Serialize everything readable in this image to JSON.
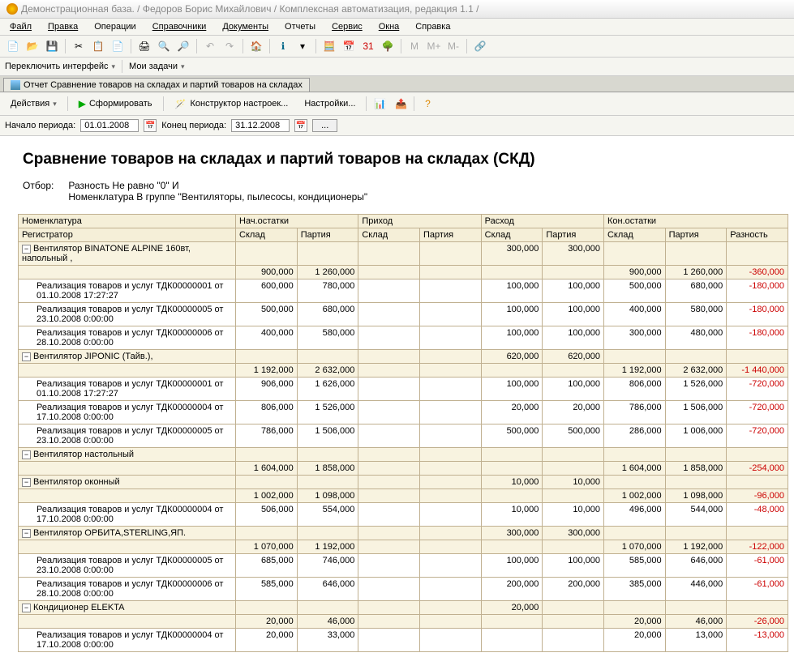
{
  "title": "Демонстрационная база. / Федоров Борис Михайлович / Комплексная автоматизация, редакция 1.1 /",
  "menu": [
    "Файл",
    "Правка",
    "Операции",
    "Справочники",
    "Документы",
    "Отчеты",
    "Сервис",
    "Окна",
    "Справка"
  ],
  "toolbar2": {
    "switch": "Переключить интерфейс",
    "tasks": "Мои задачи"
  },
  "tab": "Отчет  Сравнение товаров на складах и партий товаров на складах",
  "actions": {
    "actions": "Действия",
    "form": "Сформировать",
    "ctor": "Конструктор настроек...",
    "settings": "Настройки..."
  },
  "period": {
    "start_lbl": "Начало периода:",
    "start": "01.01.2008",
    "end_lbl": "Конец периода:",
    "end": "31.12.2008"
  },
  "report": {
    "title": "Сравнение товаров на складах и партий товаров на складах (СКД)",
    "filter_lbl": "Отбор:",
    "filter1": "Разность Не равно \"0\" И",
    "filter2": "Номенклатура В группе \"Вентиляторы, пылесосы, кондиционеры\""
  },
  "headers": {
    "nom": "Номенклатура",
    "reg": "Регистратор",
    "nach": "Нач.остатки",
    "prih": "Приход",
    "rash": "Расход",
    "kon": "Кон.остатки",
    "skl": "Склад",
    "par": "Партия",
    "raz": "Разность"
  },
  "rows": [
    {
      "type": "g",
      "name": "Вентилятор BINATONE ALPINE 160вт, напольный ,",
      "r_s": "300,000",
      "r_p": "300,000"
    },
    {
      "type": "s",
      "n_s": "900,000",
      "n_p": "1 260,000",
      "k_s": "900,000",
      "k_p": "1 260,000",
      "d": "-360,000"
    },
    {
      "type": "d",
      "name": "Реализация товаров и услуг ТДК00000001 от 01.10.2008 17:27:27",
      "n_s": "600,000",
      "n_p": "780,000",
      "r_s": "100,000",
      "r_p": "100,000",
      "k_s": "500,000",
      "k_p": "680,000",
      "d": "-180,000"
    },
    {
      "type": "d",
      "name": "Реализация товаров и услуг ТДК00000005 от 23.10.2008 0:00:00",
      "n_s": "500,000",
      "n_p": "680,000",
      "r_s": "100,000",
      "r_p": "100,000",
      "k_s": "400,000",
      "k_p": "580,000",
      "d": "-180,000"
    },
    {
      "type": "d",
      "name": "Реализация товаров и услуг ТДК00000006 от 28.10.2008 0:00:00",
      "n_s": "400,000",
      "n_p": "580,000",
      "r_s": "100,000",
      "r_p": "100,000",
      "k_s": "300,000",
      "k_p": "480,000",
      "d": "-180,000"
    },
    {
      "type": "g",
      "name": "Вентилятор JIPONIC (Тайв.),",
      "r_s": "620,000",
      "r_p": "620,000"
    },
    {
      "type": "s",
      "n_s": "1 192,000",
      "n_p": "2 632,000",
      "k_s": "1 192,000",
      "k_p": "2 632,000",
      "d": "-1 440,000"
    },
    {
      "type": "d",
      "name": "Реализация товаров и услуг ТДК00000001 от 01.10.2008 17:27:27",
      "n_s": "906,000",
      "n_p": "1 626,000",
      "r_s": "100,000",
      "r_p": "100,000",
      "k_s": "806,000",
      "k_p": "1 526,000",
      "d": "-720,000"
    },
    {
      "type": "d",
      "name": "Реализация товаров и услуг ТДК00000004 от 17.10.2008 0:00:00",
      "n_s": "806,000",
      "n_p": "1 526,000",
      "r_s": "20,000",
      "r_p": "20,000",
      "k_s": "786,000",
      "k_p": "1 506,000",
      "d": "-720,000"
    },
    {
      "type": "d",
      "name": "Реализация товаров и услуг ТДК00000005 от 23.10.2008 0:00:00",
      "n_s": "786,000",
      "n_p": "1 506,000",
      "r_s": "500,000",
      "r_p": "500,000",
      "k_s": "286,000",
      "k_p": "1 006,000",
      "d": "-720,000"
    },
    {
      "type": "g",
      "name": "Вентилятор настольный"
    },
    {
      "type": "s",
      "n_s": "1 604,000",
      "n_p": "1 858,000",
      "k_s": "1 604,000",
      "k_p": "1 858,000",
      "d": "-254,000"
    },
    {
      "type": "g",
      "name": "Вентилятор оконный",
      "r_s": "10,000",
      "r_p": "10,000"
    },
    {
      "type": "s",
      "n_s": "1 002,000",
      "n_p": "1 098,000",
      "k_s": "1 002,000",
      "k_p": "1 098,000",
      "d": "-96,000"
    },
    {
      "type": "d",
      "name": "Реализация товаров и услуг ТДК00000004 от 17.10.2008 0:00:00",
      "n_s": "506,000",
      "n_p": "554,000",
      "r_s": "10,000",
      "r_p": "10,000",
      "k_s": "496,000",
      "k_p": "544,000",
      "d": "-48,000"
    },
    {
      "type": "g",
      "name": "Вентилятор ОРБИТА,STERLING,ЯП.",
      "r_s": "300,000",
      "r_p": "300,000"
    },
    {
      "type": "s",
      "n_s": "1 070,000",
      "n_p": "1 192,000",
      "k_s": "1 070,000",
      "k_p": "1 192,000",
      "d": "-122,000"
    },
    {
      "type": "d",
      "name": "Реализация товаров и услуг ТДК00000005 от 23.10.2008 0:00:00",
      "n_s": "685,000",
      "n_p": "746,000",
      "r_s": "100,000",
      "r_p": "100,000",
      "k_s": "585,000",
      "k_p": "646,000",
      "d": "-61,000"
    },
    {
      "type": "d",
      "name": "Реализация товаров и услуг ТДК00000006 от 28.10.2008 0:00:00",
      "n_s": "585,000",
      "n_p": "646,000",
      "r_s": "200,000",
      "r_p": "200,000",
      "k_s": "385,000",
      "k_p": "446,000",
      "d": "-61,000"
    },
    {
      "type": "g",
      "name": "Кондиционер ELEKTA",
      "r_s": "20,000"
    },
    {
      "type": "s",
      "n_s": "20,000",
      "n_p": "46,000",
      "k_s": "20,000",
      "k_p": "46,000",
      "d": "-26,000"
    },
    {
      "type": "d",
      "name": "Реализация товаров и услуг ТДК00000004 от 17.10.2008 0:00:00",
      "n_s": "20,000",
      "n_p": "33,000",
      "k_s": "20,000",
      "k_p": "13,000",
      "d": "-13,000"
    }
  ]
}
